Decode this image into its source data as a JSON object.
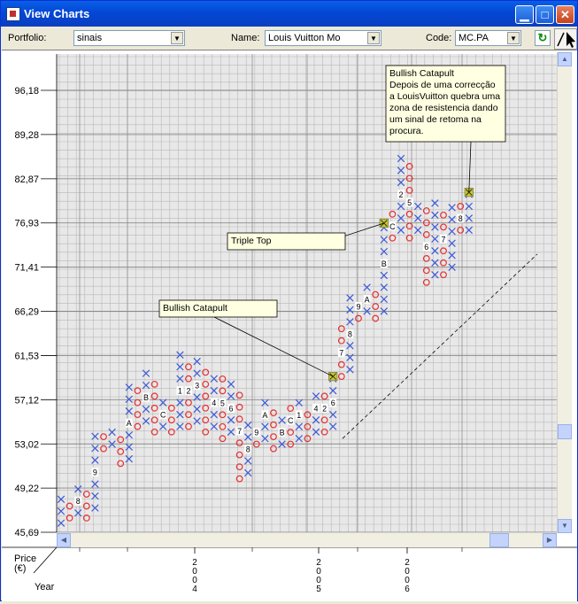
{
  "window": {
    "title": "View Charts"
  },
  "toolbar": {
    "portfolio_label": "Portfolio:",
    "portfolio_value": "sinais",
    "name_label": "Name:",
    "name_value": "Louis Vuitton Mo",
    "code_label": "Code:",
    "code_value": "MC.PA"
  },
  "icons": {
    "app": "app-icon",
    "minimize": "minimize-icon",
    "maximize": "maximize-icon",
    "close": "close-icon",
    "refresh": "refresh-icon",
    "pointer": "pointer-icon"
  },
  "colors": {
    "x_mark": "#3c5ad8",
    "o_mark": "#e83030",
    "signal": "#c8c82a",
    "grid": "#b8b8b8"
  },
  "axes": {
    "price_label": "Price (€)",
    "year_label": "Year",
    "y_ticks": [
      "96,18",
      "89,28",
      "82,87",
      "76,93",
      "71,41",
      "66,29",
      "61,53",
      "57,12",
      "53,02",
      "49,22",
      "45,69"
    ],
    "years": [
      "2004",
      "2005",
      "2006"
    ]
  },
  "annotations": [
    {
      "text": "Bullish Catapult\nDepois de uma correcção\na LouisVuitton quebra uma\nzona de resistencia dando\num sinal de retoma na\nprocura."
    },
    {
      "text": "Triple Top"
    },
    {
      "text": "Bullish Catapult"
    }
  ],
  "chart_data": {
    "type": "point-and-figure",
    "y_axis_ticks": [
      96.18,
      89.28,
      82.87,
      76.93,
      71.41,
      66.29,
      61.53,
      57.12,
      53.02,
      49.22,
      45.69
    ],
    "columns": [
      {
        "type": "X",
        "bottom": 46.4,
        "top": 48.4
      },
      {
        "type": "O",
        "bottom": 46.8,
        "top": 48.0
      },
      {
        "type": "X",
        "bottom": 47.2,
        "top": 49.2,
        "label": "8"
      },
      {
        "type": "O",
        "bottom": 46.8,
        "top": 48.4
      },
      {
        "type": "X",
        "bottom": 47.6,
        "top": 54.1,
        "label": "9"
      },
      {
        "type": "O",
        "bottom": 52.6,
        "top": 54.1
      },
      {
        "type": "X",
        "bottom": 53.0,
        "top": 54.1
      },
      {
        "type": "O",
        "bottom": 51.3,
        "top": 53.5
      },
      {
        "type": "X",
        "bottom": 51.7,
        "top": 58.2,
        "label": "A"
      },
      {
        "type": "O",
        "bottom": 54.6,
        "top": 57.6
      },
      {
        "type": "X",
        "bottom": 55.1,
        "top": 59.4,
        "label": "B"
      },
      {
        "type": "O",
        "bottom": 54.1,
        "top": 58.8
      },
      {
        "type": "X",
        "bottom": 54.6,
        "top": 57.1,
        "label": "C"
      },
      {
        "type": "O",
        "bottom": 54.1,
        "top": 56.6
      },
      {
        "type": "X",
        "bottom": 54.6,
        "top": 61.5,
        "label": "1"
      },
      {
        "type": "O",
        "bottom": 54.6,
        "top": 60.8,
        "label": "2"
      },
      {
        "type": "X",
        "bottom": 55.1,
        "top": 60.8,
        "label": "3"
      },
      {
        "type": "O",
        "bottom": 54.1,
        "top": 59.4
      },
      {
        "type": "X",
        "bottom": 54.6,
        "top": 59.4,
        "label": "4"
      },
      {
        "type": "O",
        "bottom": 53.5,
        "top": 58.8,
        "label": "5"
      },
      {
        "type": "X",
        "bottom": 54.1,
        "top": 58.2,
        "label": "6"
      },
      {
        "type": "O",
        "bottom": 50.0,
        "top": 57.6,
        "label": "7"
      },
      {
        "type": "X",
        "bottom": 50.5,
        "top": 55.1,
        "label": "8"
      },
      {
        "type": "O",
        "bottom": 53.0,
        "top": 54.6,
        "label": "9"
      },
      {
        "type": "X",
        "bottom": 53.5,
        "top": 56.6,
        "label": "A"
      },
      {
        "type": "O",
        "bottom": 52.6,
        "top": 56.1
      },
      {
        "type": "X",
        "bottom": 53.0,
        "top": 55.6,
        "label": "B"
      },
      {
        "type": "O",
        "bottom": 53.0,
        "top": 56.1,
        "label": "C"
      },
      {
        "type": "X",
        "bottom": 53.5,
        "top": 56.6,
        "label": "1"
      },
      {
        "type": "O",
        "bottom": 53.5,
        "top": 56.1
      },
      {
        "type": "X",
        "bottom": 54.1,
        "top": 57.6,
        "label": "4"
      },
      {
        "type": "O",
        "bottom": 54.1,
        "top": 57.1,
        "label": "2"
      },
      {
        "type": "X",
        "bottom": 54.6,
        "top": 59.4,
        "label": "6",
        "signal": "Bullish Catapult"
      },
      {
        "type": "O",
        "bottom": 59.4,
        "top": 64.3,
        "label": "7"
      },
      {
        "type": "X",
        "bottom": 60.1,
        "top": 67.9,
        "label": "8"
      },
      {
        "type": "O",
        "bottom": 65.5,
        "top": 67.1,
        "label": "9"
      },
      {
        "type": "X",
        "bottom": 66.3,
        "top": 68.8,
        "label": "A"
      },
      {
        "type": "O",
        "bottom": 65.5,
        "top": 67.9
      },
      {
        "type": "X",
        "bottom": 66.3,
        "top": 76.9,
        "label": "B",
        "signal": "Triple Top"
      },
      {
        "type": "O",
        "bottom": 75.0,
        "top": 77.9,
        "label": "C"
      },
      {
        "type": "X",
        "bottom": 76.0,
        "top": 86.2,
        "label": "2"
      },
      {
        "type": "O",
        "bottom": 75.0,
        "top": 84.1,
        "label": "5"
      },
      {
        "type": "X",
        "bottom": 76.0,
        "top": 78.8
      },
      {
        "type": "O",
        "bottom": 69.6,
        "top": 77.9,
        "label": "6"
      },
      {
        "type": "X",
        "bottom": 70.5,
        "top": 78.8
      },
      {
        "type": "O",
        "bottom": 70.5,
        "top": 77.9,
        "label": "7"
      },
      {
        "type": "X",
        "bottom": 71.4,
        "top": 78.8
      },
      {
        "type": "O",
        "bottom": 76.0,
        "top": 78.8,
        "label": "8"
      },
      {
        "type": "X",
        "bottom": 76.0,
        "top": 81.0,
        "signal": "Bullish Catapult"
      }
    ],
    "trendline": {
      "style": "dashed",
      "from_price": 53.5,
      "to_price": 73.0
    }
  }
}
